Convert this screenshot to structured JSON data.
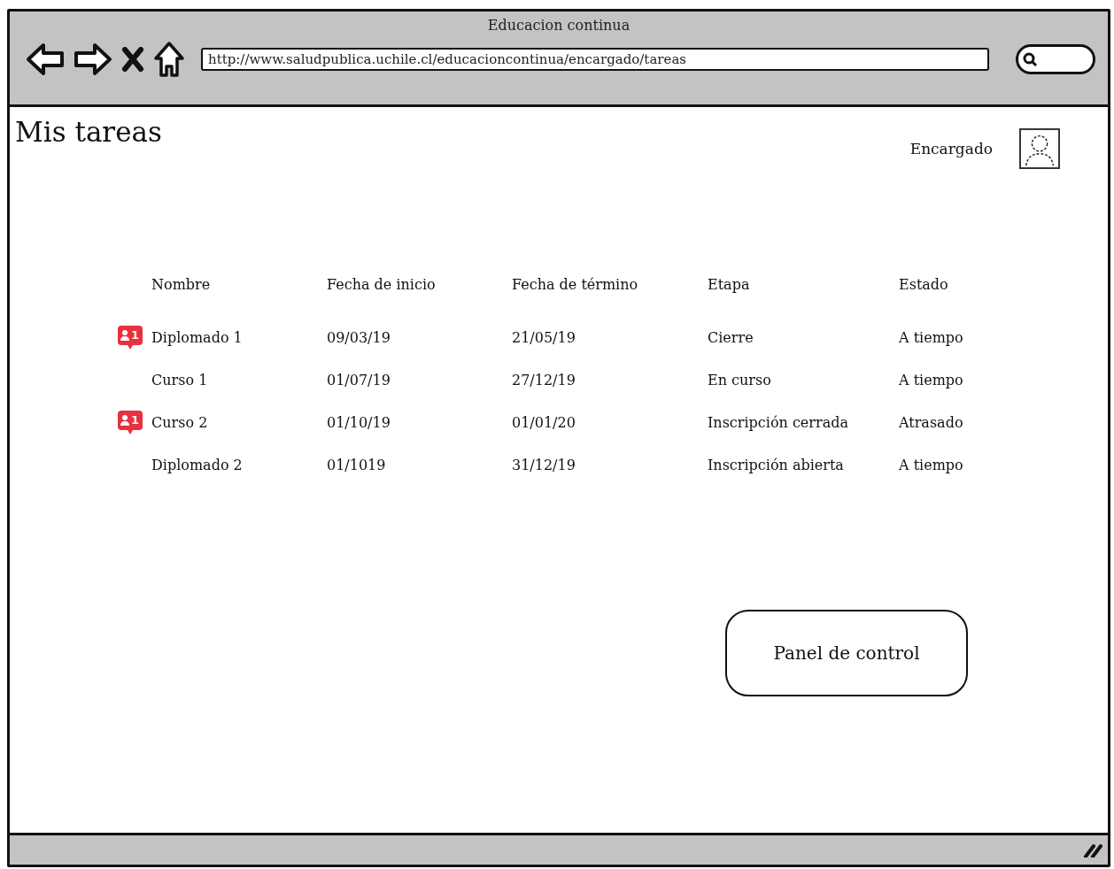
{
  "window": {
    "title": "Educacion continua",
    "url": "http://www.saludpublica.uchile.cl/educacioncontinua/encargado/tareas"
  },
  "page": {
    "title": "Mis tareas",
    "user": "Encargado"
  },
  "table": {
    "columns": [
      "Nombre",
      "Fecha de inicio",
      "Fecha de término",
      "Etapa",
      "Estado"
    ],
    "rows": [
      {
        "badge": "1",
        "cells": [
          "Diplomado 1",
          "09/03/19",
          "21/05/19",
          "Cierre",
          "A tiempo"
        ]
      },
      {
        "cells": [
          "Curso 1",
          "01/07/19",
          "27/12/19",
          "En curso",
          "A tiempo"
        ]
      },
      {
        "badge": "1",
        "cells": [
          "Curso 2",
          "01/10/19",
          "01/01/20",
          "Inscripción cerrada",
          "Atrasado"
        ]
      },
      {
        "cells": [
          "Diplomado 2",
          "01/1019",
          "31/12/19",
          "Inscripción abierta",
          "A tiempo"
        ]
      }
    ]
  },
  "buttons": [
    "Panel de control"
  ]
}
